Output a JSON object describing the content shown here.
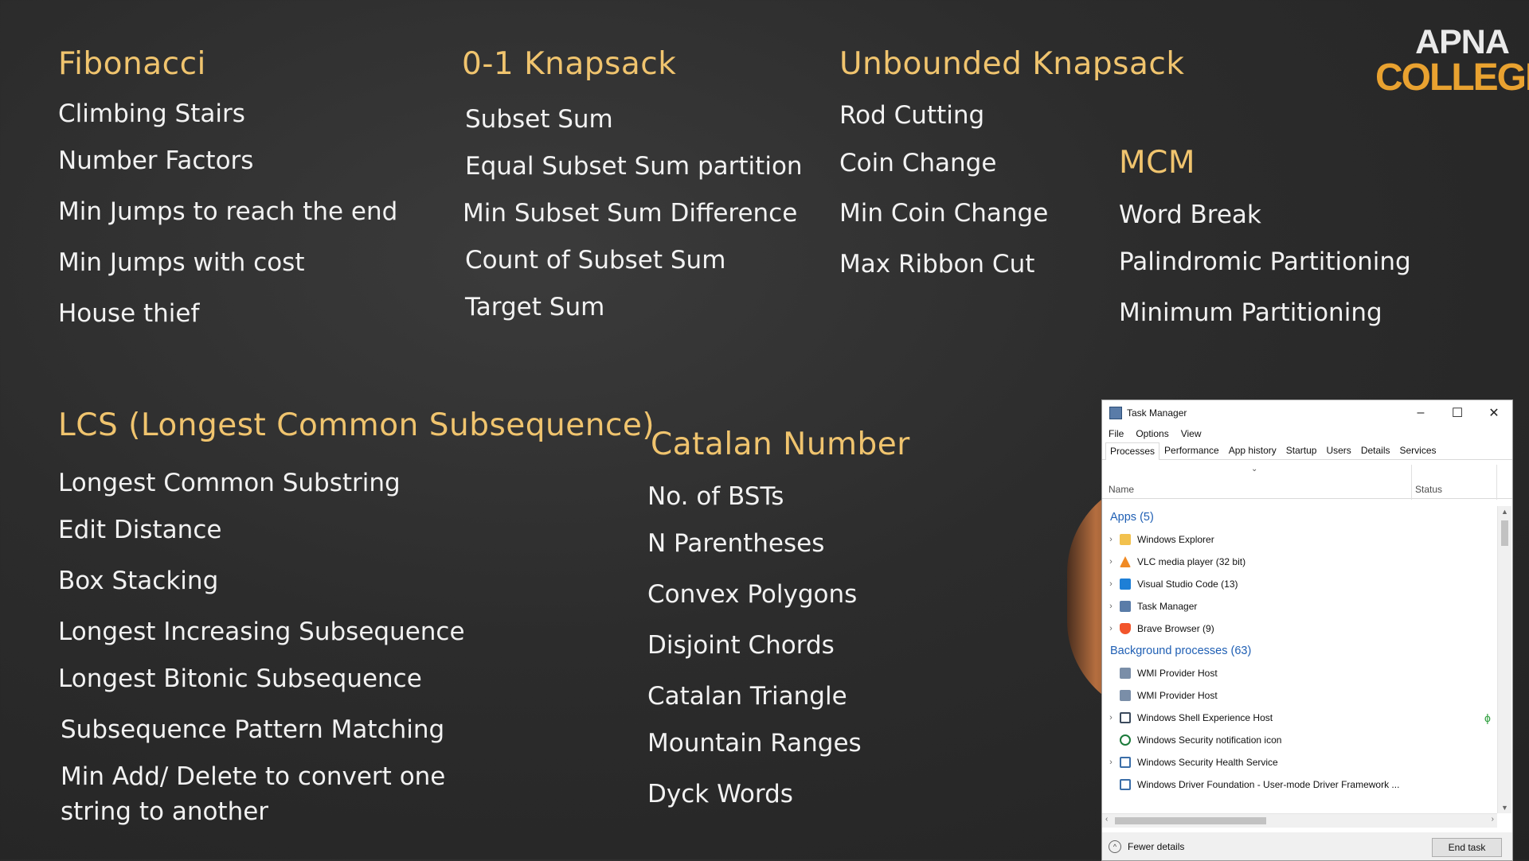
{
  "columns": [
    {
      "heading": "Fibonacci",
      "items": [
        "Climbing Stairs",
        "Number Factors",
        "Min Jumps to reach the end",
        "Min Jumps with cost",
        "House thief"
      ]
    },
    {
      "heading": "0-1 Knapsack",
      "items": [
        "Subset Sum",
        "Equal Subset Sum partition",
        "Min Subset Sum Difference",
        "Count of Subset Sum",
        "Target Sum"
      ]
    },
    {
      "heading": "Unbounded Knapsack",
      "items": [
        "Rod Cutting",
        "Coin Change",
        "Min Coin Change",
        "Max Ribbon Cut"
      ]
    },
    {
      "heading": "MCM",
      "items": [
        "Word Break",
        "Palindromic Partitioning",
        "Minimum Partitioning"
      ]
    },
    {
      "heading": "LCS (Longest Common Subsequence)",
      "items": [
        "Longest Common Substring",
        "Edit Distance",
        "Box Stacking",
        "Longest Increasing Subsequence",
        "Longest Bitonic Subsequence",
        "Subsequence Pattern Matching",
        "Min Add/ Delete to convert one",
        "string to another"
      ]
    },
    {
      "heading": "Catalan Number",
      "items": [
        "No. of BSTs",
        "N Parentheses",
        "Convex Polygons",
        "Disjoint Chords",
        "Catalan Triangle",
        "Mountain Ranges",
        "Dyck Words"
      ]
    }
  ],
  "logo": {
    "line1": "APNA",
    "line2": "COLLEGE"
  },
  "taskmanager": {
    "title": "Task Manager",
    "window_buttons": {
      "minimize": "–",
      "maximize": "☐",
      "close": "✕"
    },
    "menu": [
      "File",
      "Options",
      "View"
    ],
    "tabs": [
      "Processes",
      "Performance",
      "App history",
      "Startup",
      "Users",
      "Details",
      "Services"
    ],
    "columns": {
      "name": "Name",
      "status": "Status"
    },
    "apps_group": "Apps (5)",
    "apps": [
      {
        "name": "Windows Explorer",
        "icon": "folder-icon",
        "color": "#f2c14e"
      },
      {
        "name": "VLC media player (32 bit)",
        "icon": "vlc-icon",
        "color": "#f08a24"
      },
      {
        "name": "Visual Studio Code (13)",
        "icon": "vscode-icon",
        "color": "#1e7fd6"
      },
      {
        "name": "Task Manager",
        "icon": "taskmanager-icon",
        "color": "#5a7ca8"
      },
      {
        "name": "Brave Browser (9)",
        "icon": "brave-icon",
        "color": "#f2552c"
      }
    ],
    "bg_group": "Background processes (63)",
    "background": [
      {
        "name": "WMI Provider Host",
        "icon": "wmi-icon",
        "color": "#7a8ea8",
        "expandable": false
      },
      {
        "name": "WMI Provider Host",
        "icon": "wmi-icon",
        "color": "#7a8ea8",
        "expandable": false
      },
      {
        "name": "Windows Shell Experience Host",
        "icon": "window-icon",
        "color": "#3b4a5c",
        "expandable": true
      },
      {
        "name": "Windows Security notification icon",
        "icon": "shield-icon",
        "color": "#1b7a3a",
        "expandable": false
      },
      {
        "name": "Windows Security Health Service",
        "icon": "window-icon",
        "color": "#3b6ea8",
        "expandable": true
      },
      {
        "name": "Windows Driver Foundation - User-mode Driver Framework ...",
        "icon": "window-icon",
        "color": "#3b6ea8",
        "expandable": false
      }
    ],
    "fewer_details": "Fewer details",
    "end_task": "End task"
  }
}
